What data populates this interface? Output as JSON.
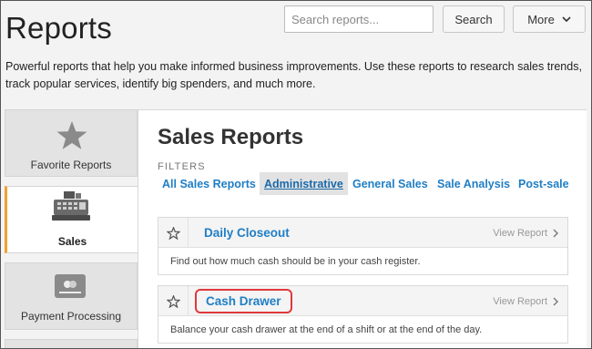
{
  "header": {
    "title": "Reports",
    "search_placeholder": "Search reports...",
    "search_label": "Search",
    "more_label": "More"
  },
  "intro": "Powerful reports that help you make informed business improvements. Use these reports to research sales trends, track popular services, identify big spenders, and much more.",
  "sidebar": {
    "items": [
      {
        "label": "Favorite Reports",
        "icon": "star-icon"
      },
      {
        "label": "Sales",
        "icon": "cash-register-icon",
        "active": true
      },
      {
        "label": "Payment Processing",
        "icon": "credit-card-icon"
      }
    ]
  },
  "main": {
    "title": "Sales Reports",
    "filters_label": "FILTERS",
    "filters": [
      "All Sales Reports",
      "Administrative",
      "General Sales",
      "Sale Analysis",
      "Post-sale"
    ],
    "active_filter": "Administrative",
    "reports": [
      {
        "title": "Daily Closeout",
        "view_label": "View Report",
        "description": "Find out how much cash should be in your cash register."
      },
      {
        "title": "Cash Drawer",
        "view_label": "View Report",
        "description": "Balance your cash drawer at the end of a shift or at the end of the day.",
        "highlighted": true
      }
    ]
  },
  "colors": {
    "link": "#1f7ec4",
    "active_accent": "#f0a030",
    "highlight": "#e0393c"
  }
}
